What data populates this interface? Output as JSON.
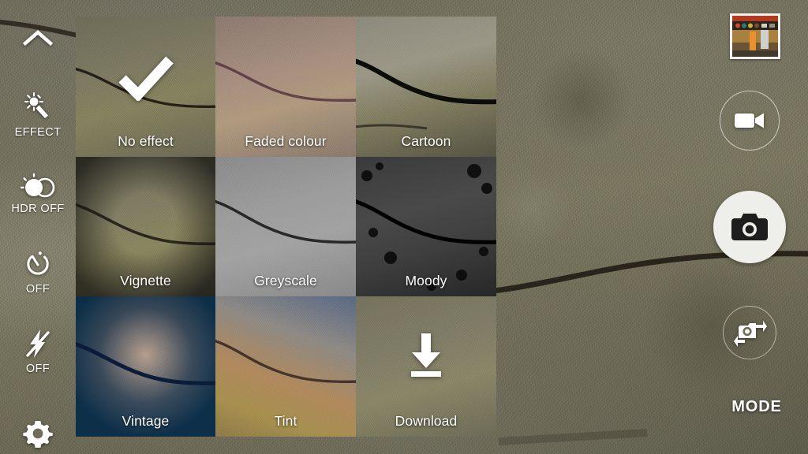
{
  "app": {
    "name": "Camera",
    "screen": "effect-picker"
  },
  "colors": {
    "accent_white": "#ffffff",
    "selected_border": "#ffffff",
    "shutter_fill": "#eeeeea",
    "overlay_text": "#ffffff"
  },
  "left_rail": {
    "items": [
      {
        "id": "collapse",
        "icon": "chevron-up-icon",
        "label": ""
      },
      {
        "id": "effect",
        "icon": "magic-wand-icon",
        "label": "EFFECT"
      },
      {
        "id": "hdr",
        "icon": "hdr-icon",
        "label": "HDR OFF"
      },
      {
        "id": "timer",
        "icon": "timer-icon",
        "label": "OFF"
      },
      {
        "id": "flash",
        "icon": "flash-off-icon",
        "label": "OFF"
      },
      {
        "id": "settings",
        "icon": "gear-icon",
        "label": ""
      }
    ]
  },
  "effect_grid": {
    "selected_index": 0,
    "tiles": [
      {
        "label": "No effect",
        "swatch": "sw-none",
        "selected": true,
        "overlay_icon": "check-icon"
      },
      {
        "label": "Faded colour",
        "swatch": "sw-faded",
        "selected": false,
        "overlay_icon": ""
      },
      {
        "label": "Cartoon",
        "swatch": "sw-cartoon",
        "selected": false,
        "overlay_icon": ""
      },
      {
        "label": "Vignette",
        "swatch": "sw-vignette",
        "selected": false,
        "overlay_icon": ""
      },
      {
        "label": "Greyscale",
        "swatch": "sw-grey",
        "selected": false,
        "overlay_icon": ""
      },
      {
        "label": "Moody",
        "swatch": "sw-moody",
        "selected": false,
        "overlay_icon": ""
      },
      {
        "label": "Vintage",
        "swatch": "sw-vintage",
        "selected": false,
        "overlay_icon": ""
      },
      {
        "label": "Tint",
        "swatch": "sw-tint",
        "selected": false,
        "overlay_icon": ""
      },
      {
        "label": "Download",
        "swatch": "sw-dl",
        "selected": false,
        "overlay_icon": "download-icon"
      }
    ]
  },
  "right_rail": {
    "gallery_thumbnail": {
      "icon": "gallery-thumbnail",
      "label": ""
    },
    "video_button": {
      "icon": "video-camera-icon",
      "label": ""
    },
    "capture_button": {
      "icon": "camera-icon",
      "label": ""
    },
    "switch_button": {
      "icon": "switch-camera-icon",
      "label": ""
    },
    "mode_label": "MODE"
  }
}
